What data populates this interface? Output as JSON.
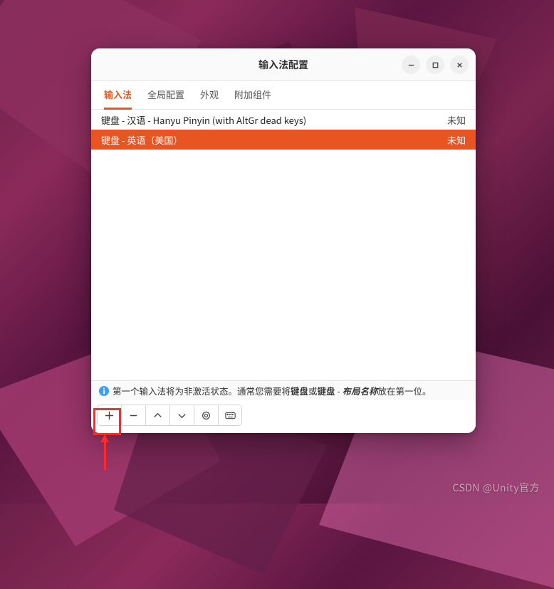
{
  "window": {
    "title": "输入法配置"
  },
  "tabs": [
    {
      "label": "输入法",
      "active": true
    },
    {
      "label": "全局配置",
      "active": false
    },
    {
      "label": "外观",
      "active": false
    },
    {
      "label": "附加组件",
      "active": false
    }
  ],
  "input_methods": [
    {
      "name": "键盘 - 汉语 - Hanyu Pinyin (with AltGr dead keys)",
      "status": "未知",
      "selected": false
    },
    {
      "name": "键盘 - 英语（美国）",
      "status": "未知",
      "selected": true
    }
  ],
  "hint": {
    "prefix": "第一个输入法将为非激活状态。通常您需要将",
    "bold1": "键盘",
    "mid": "或",
    "bold2": "键盘",
    "dash": " - ",
    "italic": "布局名称",
    "suffix": "放在第一位。"
  },
  "toolbar": {
    "add": "+",
    "remove": "−",
    "up": "˄",
    "down": "˅",
    "config": "⚙",
    "keyboard": "⌨"
  },
  "watermark": "CSDN @Unity官方",
  "colors": {
    "accent": "#e95420",
    "highlight": "#ff2a2a"
  }
}
